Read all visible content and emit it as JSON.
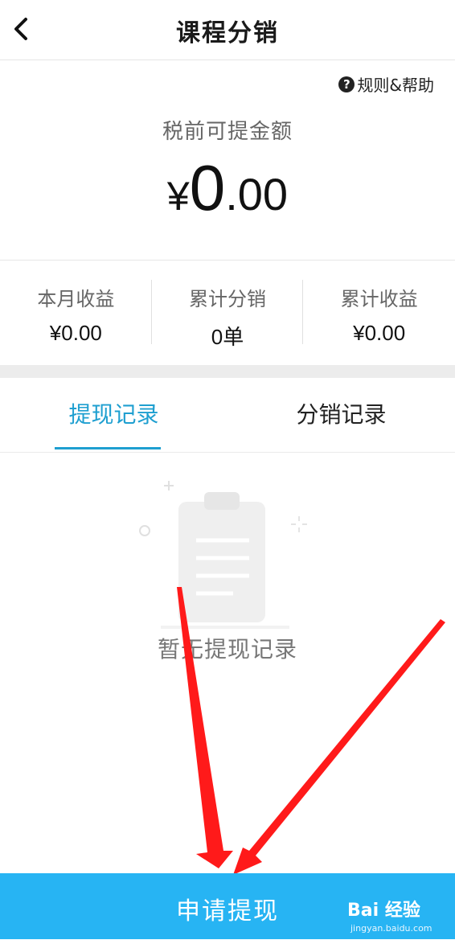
{
  "header": {
    "title": "课程分销",
    "back_icon": "chevron-left-icon"
  },
  "help": {
    "label": "规则&帮助",
    "icon": "question-circle-icon"
  },
  "balance": {
    "label": "税前可提金额",
    "currency": "¥",
    "integer": "0",
    "decimal": ".00"
  },
  "stats": [
    {
      "label": "本月收益",
      "value": "¥0.00"
    },
    {
      "label": "累计分销",
      "value": "0单"
    },
    {
      "label": "累计收益",
      "value": "¥0.00"
    }
  ],
  "tabs": [
    {
      "label": "提现记录",
      "active": true
    },
    {
      "label": "分销记录",
      "active": false
    }
  ],
  "empty_state": {
    "text": "暂无提现记录",
    "icon": "clipboard-icon"
  },
  "bottom_button": {
    "label": "申请提现"
  },
  "watermark": {
    "text": "Bai 经验",
    "sub": "jingyan.baidu.com"
  },
  "colors": {
    "accent": "#1e9fd0",
    "button": "#27b4f3",
    "annotation_arrow": "#ff1a1a"
  }
}
